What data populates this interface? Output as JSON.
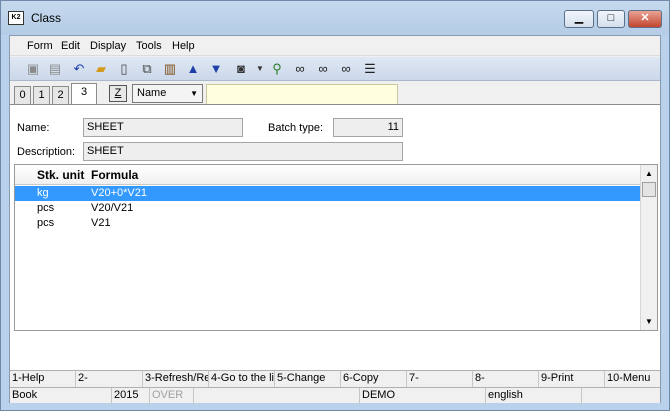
{
  "window": {
    "title": "Class",
    "app_icon_text": "K2",
    "buttons": {
      "minimize": "▁",
      "maximize": "□",
      "close": "✕"
    }
  },
  "menu": [
    "Form",
    "Edit",
    "Display",
    "Tools",
    "Help"
  ],
  "toolbar": [
    "save-icon",
    "save-as-icon",
    "undo-icon",
    "open-folder-icon",
    "new-document-icon",
    "copy-icon",
    "book-icon",
    "arrow-up-icon",
    "arrow-down-icon",
    "camera-icon",
    "dropdown-arrow-icon",
    "filter-icon",
    "binoculars-icon",
    "binoculars-next-icon",
    "binoculars-prev-icon",
    "list-icon"
  ],
  "tabs": [
    "0",
    "1",
    "2",
    "3"
  ],
  "active_tab": "3",
  "z_button": "Z",
  "sort_select": {
    "value": "Name"
  },
  "search": {
    "value": ""
  },
  "form": {
    "name_label": "Name:",
    "name_value": "SHEET",
    "batch_type_label": "Batch type:",
    "batch_type_value": "11",
    "description_label": "Description:",
    "description_value": "SHEET"
  },
  "grid": {
    "columns": [
      "Stk. unit",
      "Formula"
    ],
    "rows": [
      {
        "unit": "kg",
        "formula": "V20+0*V21",
        "selected": true
      },
      {
        "unit": "pcs",
        "formula": "V20/V21",
        "selected": false
      },
      {
        "unit": "pcs",
        "formula": "V21",
        "selected": false
      }
    ]
  },
  "fkeys": [
    "1-Help",
    "2-",
    "3-Refresh/Re",
    "4-Go to the li",
    "5-Change",
    "6-Copy",
    "7-",
    "8-",
    "9-Print",
    "10-Menu"
  ],
  "status": {
    "module": "Book",
    "year": "2015",
    "mode": "OVER",
    "db": "DEMO",
    "language": "english"
  },
  "colors": {
    "selection": "#3399ff",
    "search_bg": "#ffffdf",
    "titlebar": "#b9d1ea"
  }
}
